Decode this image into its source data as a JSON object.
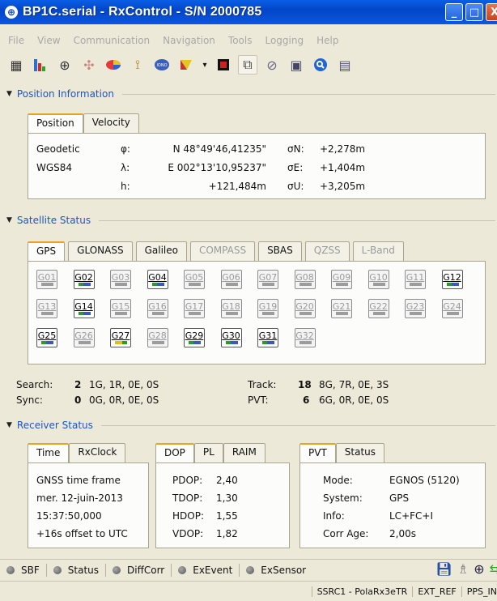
{
  "window": {
    "title": "BP1C.serial - RxControl - S/N 2000785",
    "minimize": "_",
    "maximize": "□",
    "close": "X"
  },
  "menu": [
    "File",
    "View",
    "Communication",
    "Navigation",
    "Tools",
    "Logging",
    "Help"
  ],
  "toolbar": [
    "grid-icon",
    "bar-chart-icon",
    "crosshair-icon",
    "sky-plot-icon",
    "pie-chart-icon",
    "antenna-icon",
    "iono-icon",
    "flag-icon",
    "dropdown-arrow-icon",
    "record-icon",
    "satellite-icon",
    "tracking-icon",
    "image-icon",
    "search-icon",
    "document-icon"
  ],
  "position_section": {
    "label": "Position Information",
    "tabs": [
      "Position",
      "Velocity"
    ],
    "rows": [
      {
        "c1": "Geodetic",
        "c2": "φ:",
        "c3": "N 48°49'46,41235\"",
        "c4": "σN:",
        "c5": "+2,278m"
      },
      {
        "c1": "WGS84",
        "c2": "λ:",
        "c3": "E 002°13'10,95237\"",
        "c4": "σE:",
        "c5": "+1,404m"
      },
      {
        "c1": "",
        "c2": "h:",
        "c3": "+121,484m",
        "c4": "σU:",
        "c5": "+3,205m"
      }
    ]
  },
  "satellite_section": {
    "label": "Satellite Status",
    "tabs": [
      "GPS",
      "GLONASS",
      "Galileo",
      "COMPASS",
      "SBAS",
      "QZSS",
      "L-Band"
    ],
    "satellites": [
      {
        "id": "G01",
        "on": false
      },
      {
        "id": "G02",
        "on": true,
        "bar": "g"
      },
      {
        "id": "G03",
        "on": false
      },
      {
        "id": "G04",
        "on": true,
        "bar": "g"
      },
      {
        "id": "G05",
        "on": false
      },
      {
        "id": "G06",
        "on": false
      },
      {
        "id": "G07",
        "on": false
      },
      {
        "id": "G08",
        "on": false
      },
      {
        "id": "G09",
        "on": false
      },
      {
        "id": "G10",
        "on": false
      },
      {
        "id": "G11",
        "on": false
      },
      {
        "id": "G12",
        "on": true,
        "bar": "g"
      },
      {
        "id": "G13",
        "on": false
      },
      {
        "id": "G14",
        "on": true,
        "bar": "g"
      },
      {
        "id": "G15",
        "on": false
      },
      {
        "id": "G16",
        "on": false
      },
      {
        "id": "G17",
        "on": false
      },
      {
        "id": "G18",
        "on": false
      },
      {
        "id": "G19",
        "on": false
      },
      {
        "id": "G20",
        "on": false
      },
      {
        "id": "G21",
        "on": false
      },
      {
        "id": "G22",
        "on": false
      },
      {
        "id": "G23",
        "on": false
      },
      {
        "id": "G24",
        "on": false
      },
      {
        "id": "G25",
        "on": true,
        "bar": "g"
      },
      {
        "id": "G26",
        "on": false
      },
      {
        "id": "G27",
        "on": true,
        "bar": "y"
      },
      {
        "id": "G28",
        "on": false
      },
      {
        "id": "G29",
        "on": true,
        "bar": "g"
      },
      {
        "id": "G30",
        "on": true,
        "bar": "g"
      },
      {
        "id": "G31",
        "on": true,
        "bar": "g"
      },
      {
        "id": "G32",
        "on": false
      }
    ],
    "search_label": "Search:",
    "search_count": "2",
    "search_detail": "1G, 1R, 0E, 0S",
    "sync_label": "Sync:",
    "sync_count": "0",
    "sync_detail": "0G, 0R, 0E, 0S",
    "track_label": "Track:",
    "track_count": "18",
    "track_detail": "8G, 7R, 0E, 3S",
    "pvt_label": "PVT:",
    "pvt_count": "6",
    "pvt_detail": "6G, 0R, 0E, 0S"
  },
  "receiver_section": {
    "label": "Receiver Status",
    "time_tabs": [
      "Time",
      "RxClock"
    ],
    "time_lines": [
      "GNSS time frame",
      "mer. 12-juin-2013",
      "15:37:50,000",
      "+16s offset to UTC"
    ],
    "dop_tabs": [
      "DOP",
      "PL",
      "RAIM"
    ],
    "dop_rows": [
      {
        "k": "PDOP:",
        "v": "2,40"
      },
      {
        "k": "TDOP:",
        "v": "1,30"
      },
      {
        "k": "HDOP:",
        "v": "1,55"
      },
      {
        "k": "VDOP:",
        "v": "1,82"
      }
    ],
    "pvt_tabs": [
      "PVT",
      "Status"
    ],
    "pvt_rows": [
      {
        "k": "Mode:",
        "v": "EGNOS (5120)"
      },
      {
        "k": "System:",
        "v": "GPS"
      },
      {
        "k": "Info:",
        "v": "LC+FC+I"
      },
      {
        "k": "Corr Age:",
        "v": "2,00s"
      }
    ]
  },
  "statusbar": {
    "indicators": [
      "SBF",
      "Status",
      "DiffCorr",
      "ExEvent",
      "ExSensor"
    ]
  },
  "bottombar": [
    "SSRC1 - PolaRx3eTR",
    "EXT_REF",
    "PPS_IN"
  ]
}
